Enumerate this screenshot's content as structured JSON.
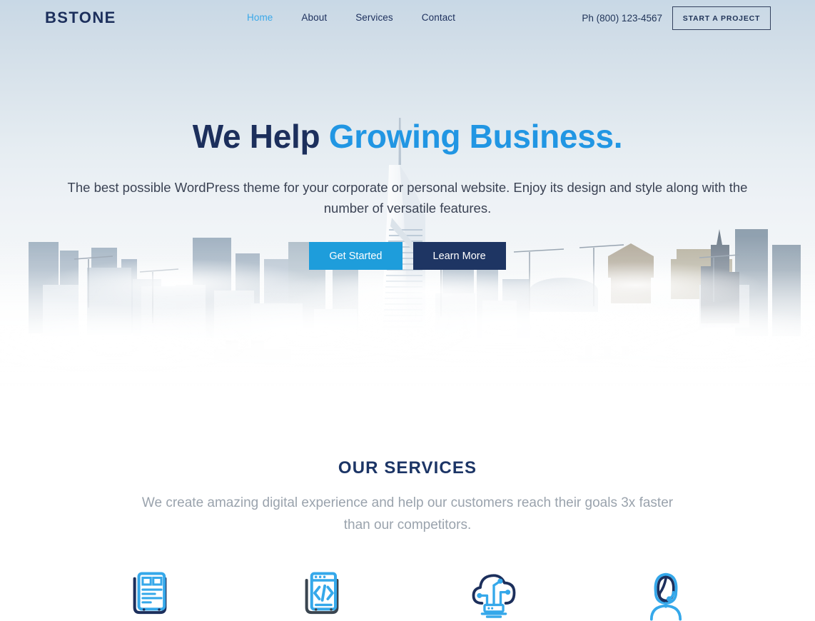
{
  "header": {
    "logo": "BSTONE",
    "nav": [
      {
        "label": "Home",
        "active": true
      },
      {
        "label": "About",
        "active": false
      },
      {
        "label": "Services",
        "active": false
      },
      {
        "label": "Contact",
        "active": false
      }
    ],
    "phone": "Ph (800) 123-4567",
    "cta_label": "START A PROJECT"
  },
  "hero": {
    "title_plain": "We Help ",
    "title_accent": "Growing Business.",
    "subtitle": "The best possible WordPress theme for your corporate or personal website. Enjoy its design and style along with the number of versatile features.",
    "primary_button": "Get Started",
    "secondary_button": "Learn More",
    "background_description": "foggy city skyline with skyscrapers above clouds"
  },
  "services": {
    "heading": "OUR SERVICES",
    "subheading": "We create amazing digital experience and help our customers reach their goals 3x faster than our competitors.",
    "items": [
      {
        "icon": "newspaper-content-icon"
      },
      {
        "icon": "code-window-icon"
      },
      {
        "icon": "cloud-server-icon"
      },
      {
        "icon": "support-headset-icon"
      }
    ]
  },
  "colors": {
    "navy": "#1c2f5c",
    "accent_blue": "#2196e3",
    "button_blue": "#1e9ddb",
    "button_navy": "#1e3563",
    "muted_text": "#9aa3ad",
    "sky_top": "#c8d8e6"
  }
}
